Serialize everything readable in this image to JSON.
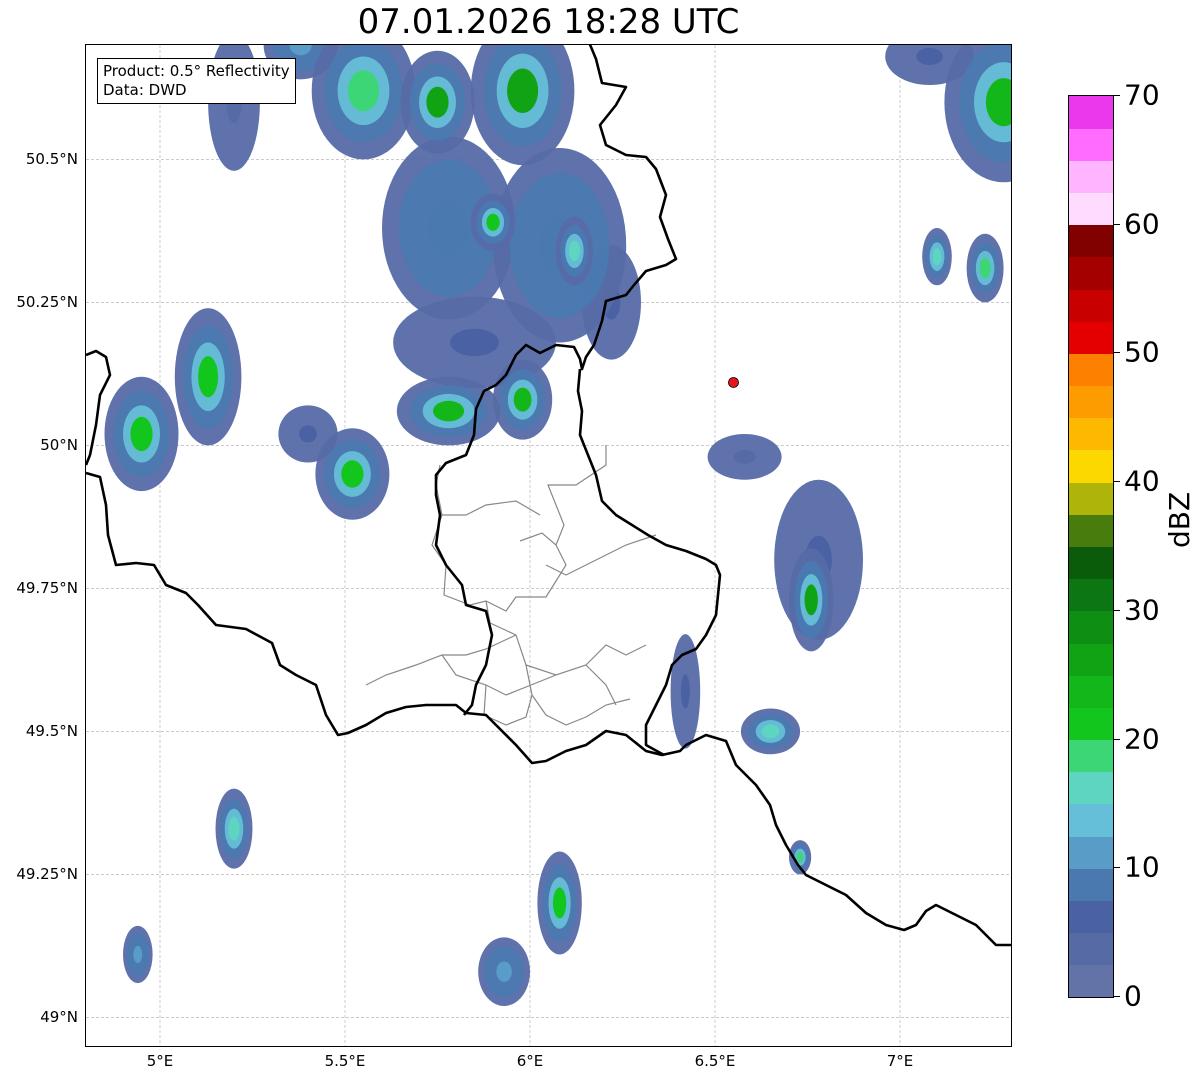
{
  "title": "07.01.2026 18:28 UTC",
  "info": {
    "product": "Product: 0.5° Reflectivity",
    "data": "Data: DWD"
  },
  "map_data": {
    "type": "radar-reflectivity",
    "lon_range": [
      4.8,
      7.3
    ],
    "lat_range": [
      48.95,
      50.7
    ],
    "x_ticks": [
      "5°E",
      "5.5°E",
      "6°E",
      "6.5°E",
      "7°E"
    ],
    "x_tick_values": [
      5.0,
      5.5,
      6.0,
      6.5,
      7.0
    ],
    "y_ticks": [
      "49°N",
      "49.25°N",
      "49.5°N",
      "49.75°N",
      "50°N",
      "50.25°N",
      "50.5°N"
    ],
    "y_tick_values": [
      49.0,
      49.25,
      49.5,
      49.75,
      50.0,
      50.25,
      50.5
    ],
    "grid": true,
    "radar_site": {
      "lon": 6.55,
      "lat": 50.11,
      "color": "#e8141c"
    },
    "echo_cells": [
      {
        "lon": 5.2,
        "lat": 50.6,
        "rx": 0.07,
        "ry": 0.12,
        "dbz": 3
      },
      {
        "lon": 5.38,
        "lat": 50.7,
        "rx": 0.1,
        "ry": 0.06,
        "dbz": 12
      },
      {
        "lon": 5.55,
        "lat": 50.62,
        "rx": 0.14,
        "ry": 0.12,
        "dbz": 18
      },
      {
        "lon": 5.75,
        "lat": 50.6,
        "rx": 0.1,
        "ry": 0.09,
        "dbz": 25
      },
      {
        "lon": 5.98,
        "lat": 50.62,
        "rx": 0.14,
        "ry": 0.13,
        "dbz": 26
      },
      {
        "lon": 5.78,
        "lat": 50.38,
        "rx": 0.18,
        "ry": 0.16,
        "dbz": 8
      },
      {
        "lon": 5.9,
        "lat": 50.39,
        "rx": 0.06,
        "ry": 0.05,
        "dbz": 22
      },
      {
        "lon": 6.08,
        "lat": 50.35,
        "rx": 0.18,
        "ry": 0.17,
        "dbz": 9
      },
      {
        "lon": 6.12,
        "lat": 50.34,
        "rx": 0.05,
        "ry": 0.06,
        "dbz": 17
      },
      {
        "lon": 6.22,
        "lat": 50.25,
        "rx": 0.08,
        "ry": 0.1,
        "dbz": 7
      },
      {
        "lon": 5.85,
        "lat": 50.18,
        "rx": 0.22,
        "ry": 0.08,
        "dbz": 6
      },
      {
        "lon": 5.78,
        "lat": 50.06,
        "rx": 0.14,
        "ry": 0.06,
        "dbz": 24
      },
      {
        "lon": 5.98,
        "lat": 50.08,
        "rx": 0.08,
        "ry": 0.07,
        "dbz": 23
      },
      {
        "lon": 5.13,
        "lat": 50.12,
        "rx": 0.09,
        "ry": 0.12,
        "dbz": 22
      },
      {
        "lon": 4.95,
        "lat": 50.02,
        "rx": 0.1,
        "ry": 0.1,
        "dbz": 20
      },
      {
        "lon": 5.52,
        "lat": 49.95,
        "rx": 0.1,
        "ry": 0.08,
        "dbz": 22
      },
      {
        "lon": 5.4,
        "lat": 50.02,
        "rx": 0.08,
        "ry": 0.05,
        "dbz": 6
      },
      {
        "lon": 7.28,
        "lat": 50.6,
        "rx": 0.16,
        "ry": 0.14,
        "dbz": 24
      },
      {
        "lon": 7.08,
        "lat": 50.68,
        "rx": 0.12,
        "ry": 0.05,
        "dbz": 5
      },
      {
        "lon": 7.1,
        "lat": 50.33,
        "rx": 0.04,
        "ry": 0.05,
        "dbz": 17
      },
      {
        "lon": 7.23,
        "lat": 50.31,
        "rx": 0.05,
        "ry": 0.06,
        "dbz": 18
      },
      {
        "lon": 6.76,
        "lat": 49.73,
        "rx": 0.06,
        "ry": 0.09,
        "dbz": 25
      },
      {
        "lon": 6.78,
        "lat": 49.8,
        "rx": 0.12,
        "ry": 0.14,
        "dbz": 6
      },
      {
        "lon": 6.65,
        "lat": 49.5,
        "rx": 0.08,
        "ry": 0.04,
        "dbz": 17
      },
      {
        "lon": 6.42,
        "lat": 49.57,
        "rx": 0.04,
        "ry": 0.1,
        "dbz": 6
      },
      {
        "lon": 5.2,
        "lat": 49.33,
        "rx": 0.05,
        "ry": 0.07,
        "dbz": 17
      },
      {
        "lon": 4.94,
        "lat": 49.11,
        "rx": 0.04,
        "ry": 0.05,
        "dbz": 12
      },
      {
        "lon": 6.08,
        "lat": 49.2,
        "rx": 0.06,
        "ry": 0.09,
        "dbz": 22
      },
      {
        "lon": 5.93,
        "lat": 49.08,
        "rx": 0.07,
        "ry": 0.06,
        "dbz": 11
      },
      {
        "lon": 6.73,
        "lat": 49.28,
        "rx": 0.03,
        "ry": 0.03,
        "dbz": 18
      },
      {
        "lon": 6.58,
        "lat": 49.98,
        "rx": 0.1,
        "ry": 0.04,
        "dbz": 3
      }
    ]
  },
  "colorbar": {
    "unit": "dBZ",
    "min": 0,
    "max": 70,
    "step": 2.5,
    "tick_values": [
      0,
      10,
      20,
      30,
      40,
      50,
      60,
      70
    ],
    "tick_labels": [
      "0",
      "10",
      "20",
      "30",
      "40",
      "50",
      "60",
      "70"
    ],
    "colors": [
      "#6373a8",
      "#566aa6",
      "#4a62a4",
      "#4a79b0",
      "#5a9cc8",
      "#66bfd8",
      "#5dd5c0",
      "#3dd676",
      "#12c61e",
      "#13b71a",
      "#12a315",
      "#0e8e12",
      "#0c7612",
      "#0a5c0b",
      "#487c0c",
      "#afb40a",
      "#fdd800",
      "#fdb800",
      "#fd9c00",
      "#fd8000",
      "#e40000",
      "#c90000",
      "#a50000",
      "#810000",
      "#ffdcff",
      "#ffb4ff",
      "#ff6cff",
      "#ec38ec"
    ]
  }
}
